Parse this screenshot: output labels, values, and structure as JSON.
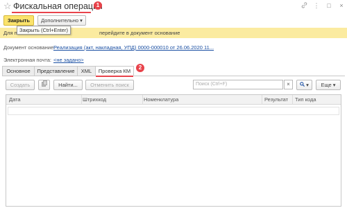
{
  "window": {
    "title": "Фискальная операция",
    "marker_title": "1",
    "marker_tab": "2",
    "controls": [
      "link-icon",
      "more-icon",
      "maximize-icon",
      "close-icon"
    ]
  },
  "toolbar": {
    "close_label": "Закрыть",
    "more_label": "Дополнительно"
  },
  "tooltip": {
    "text": "Закрыть (Ctrl+Enter)"
  },
  "banner": {
    "prefix": "Для п",
    "suffix": "перейдите в документ основание"
  },
  "fields": {
    "base_doc_label": "Документ основание:",
    "base_doc_value": "Реализация (акт, накладная, УПД) 0000-000010 от 26.06.2020 11...",
    "email_label": "Электронная почта:",
    "email_value": "<не задано>"
  },
  "tabs": [
    {
      "label": "Основное"
    },
    {
      "label": "Представление"
    },
    {
      "label": "XML"
    },
    {
      "label": "Проверка КМ"
    }
  ],
  "table_toolbar": {
    "create_label": "Создать",
    "find_label": "Найти...",
    "cancel_search_label": "Отменить поиск",
    "search_placeholder": "Поиск (Ctrl+F)",
    "clear_label": "×",
    "more_label": "Еще"
  },
  "table": {
    "columns": [
      "Дата",
      "Штрихкод",
      "Номенклатура",
      "Результат",
      "Тип кода"
    ]
  },
  "colors": {
    "accent_yellow": "#fbe36b",
    "banner_yellow": "#fbeba0",
    "marker_red": "#e8434b",
    "link_blue": "#1a4fa3"
  }
}
